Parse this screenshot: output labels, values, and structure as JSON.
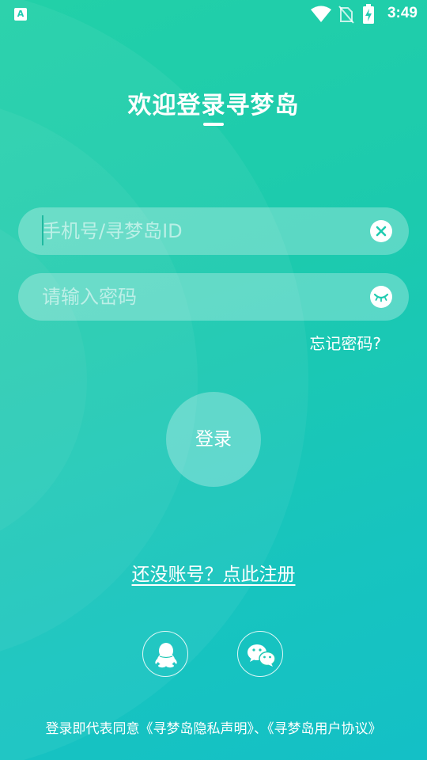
{
  "status_bar": {
    "app_icon_letter": "A",
    "time": "3:49",
    "icons": [
      "app-notification-icon",
      "wifi-icon",
      "no-sim-icon",
      "battery-charging-icon"
    ]
  },
  "login": {
    "title": "欢迎登录寻梦岛",
    "phone_placeholder": "手机号/寻梦岛ID",
    "phone_value": "",
    "phone_clear_icon": "clear-icon",
    "password_placeholder": "请输入密码",
    "password_value": "",
    "password_toggle_icon": "eye-closed-icon",
    "forgot_label": "忘记密码?",
    "submit_label": "登录",
    "register_label": "还没账号？点此注册"
  },
  "social_login": {
    "items": [
      {
        "name": "qq",
        "icon": "qq-icon"
      },
      {
        "name": "wechat",
        "icon": "wechat-icon"
      }
    ]
  },
  "footer": {
    "agreement": "登录即代表同意《寻梦岛隐私声明》、《寻梦岛用户协议》"
  },
  "colors": {
    "gradient_start": "#22d0a8",
    "gradient_end": "#14c0c6",
    "accent": "#1fcbb0",
    "text": "#ffffff"
  }
}
